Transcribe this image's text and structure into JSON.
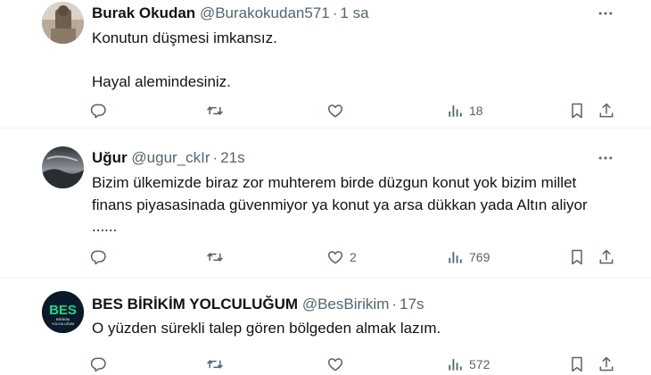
{
  "tweets": [
    {
      "name": "Burak Okudan",
      "handle": "@Burakokudan571",
      "dot": "·",
      "time": "1 sa",
      "text": [
        "Konutun düşmesi imkansız.",
        "",
        "Hayal alemindesiniz."
      ],
      "stats": {
        "replies": "",
        "retweets": "",
        "likes": "",
        "views": "18"
      },
      "avatar": "photo",
      "colors": {
        "avatar": "#8a7a68"
      }
    },
    {
      "name": "Uğur",
      "handle": "@ugur_ckIr",
      "dot": "·",
      "time": "21s",
      "text": [
        "Bizim ülkemizde biraz zor muhterem birde düzgun konut yok bizim millet finans piyasasinada güvenmiyor ya konut ya arsa dükkan yada Altın aliyor",
        "......"
      ],
      "stats": {
        "replies": "",
        "retweets": "",
        "likes": "2",
        "views": "769"
      },
      "avatar": "storm-sky",
      "colors": {
        "avatar": "#4a4f54"
      }
    },
    {
      "name": "BES BİRİKİM YOLCULUĞUM",
      "handle": "@BesBirikim",
      "dot": "·",
      "time": "17s",
      "text": [
        "O yüzden sürekli talep gören bölgeden almak lazım."
      ],
      "stats": {
        "replies": "",
        "retweets": "",
        "likes": "",
        "views": "572"
      },
      "avatar": "logo",
      "avatar_logo": {
        "mark": "BES",
        "sub": "BİRİKİM",
        "sub2": "YOLCULUĞUM"
      },
      "colors": {
        "avatar": "#0b1a2a",
        "logo": "#1fd68f"
      }
    }
  ],
  "colors": {
    "text": "#0f1419",
    "secondary": "#536471",
    "divider": "#eff3f4"
  },
  "icons": {
    "more": "more-horizontal-icon",
    "reply": "reply-icon",
    "retweet": "retweet-icon",
    "like": "like-icon",
    "views": "views-icon",
    "bookmark": "bookmark-icon",
    "share": "share-icon"
  }
}
